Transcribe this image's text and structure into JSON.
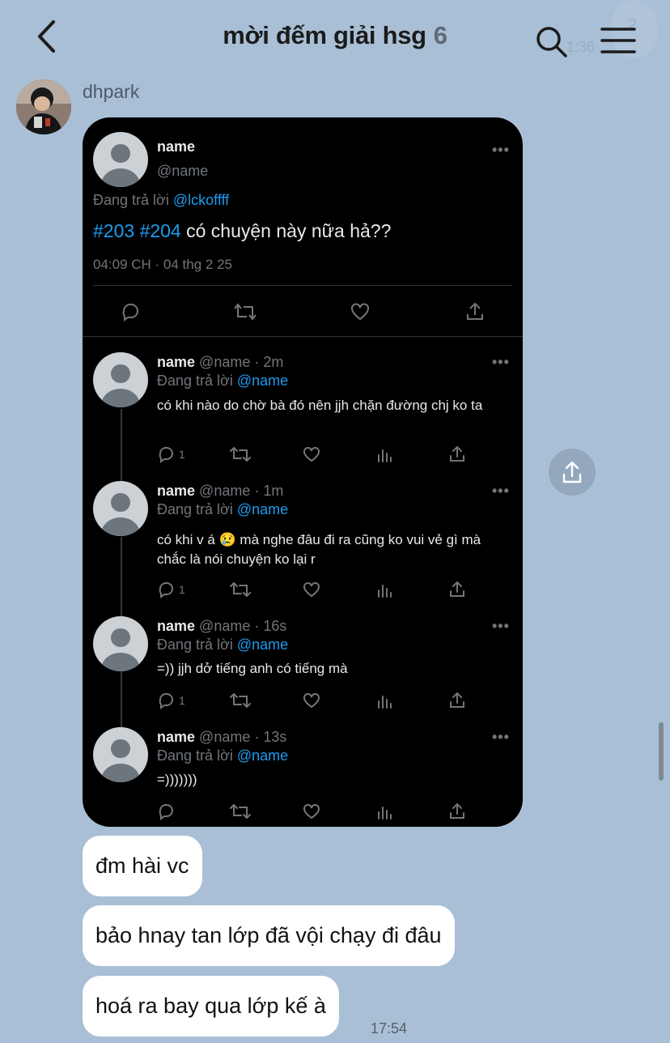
{
  "header": {
    "title": "mời đếm giải hsg",
    "member_count": "6",
    "ghost_time": "1:36",
    "ghost_number": "2"
  },
  "sender": {
    "name": "dhpark"
  },
  "tweet": {
    "main": {
      "name": "name",
      "handle": "@name",
      "replying_prefix": "Đang trả lời",
      "replying_to": "@lckoffff",
      "hashtag1": "#203",
      "hashtag2": "#204",
      "text": "có chuyện này nữa hả??",
      "timestamp": "04:09 CH · 04 thg 2 25"
    },
    "replies": [
      {
        "name": "name",
        "meta": "@name · 2m",
        "replying_prefix": "Đang trả lời",
        "replying_to": "@name",
        "text": "có khi nào do chờ bà đó nên jjh chặn đường chj ko ta",
        "reply_count": "1"
      },
      {
        "name": "name",
        "meta": "@name · 1m",
        "replying_prefix": "Đang trả lời",
        "replying_to": "@name",
        "text": "có khi v á 😢  mà nghe đâu đi ra cũng ko vui vẻ gì mà chắc là nói chuyện ko lại r",
        "reply_count": "1"
      },
      {
        "name": "name",
        "meta": "@name · 16s",
        "replying_prefix": "Đang trả lời",
        "replying_to": "@name",
        "text": "=)) jjh dở tiếng anh có tiếng mà",
        "reply_count": "1"
      },
      {
        "name": "name",
        "meta": "@name · 13s",
        "replying_prefix": "Đang trả lời",
        "replying_to": "@name",
        "text": "=)))))))",
        "reply_count": ""
      }
    ]
  },
  "messages": [
    {
      "text": "đm hài vc"
    },
    {
      "text": "bảo hnay tan lớp đã vội chạy đi đâu"
    },
    {
      "text": "hoá ra bay qua lớp kế à"
    }
  ],
  "last_message_time": "17:54",
  "icons": {
    "back": "chevron-left-icon",
    "search": "search-icon",
    "menu": "hamburger-menu-icon",
    "share": "share-icon",
    "reply": "reply-icon",
    "retweet": "retweet-icon",
    "like": "heart-icon",
    "views": "analytics-icon"
  },
  "colors": {
    "background": "#a9bfd6",
    "tweet_bg": "#000000",
    "link_blue": "#1d9bf0",
    "bubble": "#ffffff"
  }
}
